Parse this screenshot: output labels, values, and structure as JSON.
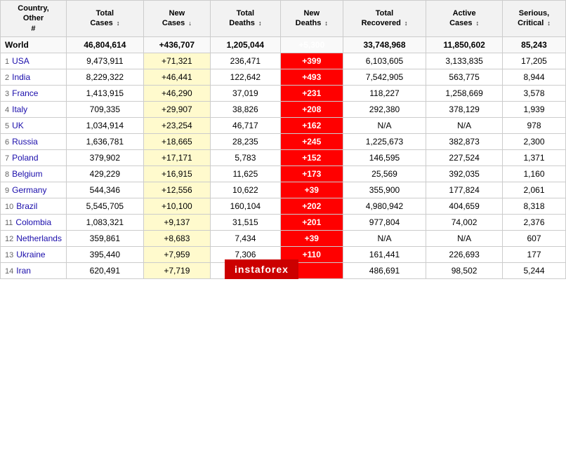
{
  "header": {
    "cols": [
      {
        "label": "Country,\nOther\n#",
        "class": "rank-col country-col-h"
      },
      {
        "label": "Total\nCases",
        "sort": true
      },
      {
        "label": "New\nCases",
        "sort": true,
        "active": true
      },
      {
        "label": "Total\nDeaths",
        "sort": true
      },
      {
        "label": "New\nDeaths",
        "sort": true
      },
      {
        "label": "Total\nRecovered",
        "sort": true
      },
      {
        "label": "Active\nCases",
        "sort": true
      },
      {
        "label": "Serious,\nCritical",
        "sort": true
      }
    ]
  },
  "world_row": {
    "name": "World",
    "total_cases": "46,804,614",
    "new_cases": "+436,707",
    "total_deaths": "1,205,044",
    "new_deaths": "+5,300",
    "total_recovered": "33,748,968",
    "active_cases": "11,850,602",
    "serious": "85,243"
  },
  "rows": [
    {
      "rank": "1",
      "country": "USA",
      "total_cases": "9,473,911",
      "new_cases": "+71,321",
      "total_deaths": "236,471",
      "new_deaths": "+399",
      "total_recovered": "6,103,605",
      "active_cases": "3,133,835",
      "serious": "17,205"
    },
    {
      "rank": "2",
      "country": "India",
      "total_cases": "8,229,322",
      "new_cases": "+46,441",
      "total_deaths": "122,642",
      "new_deaths": "+493",
      "total_recovered": "7,542,905",
      "active_cases": "563,775",
      "serious": "8,944"
    },
    {
      "rank": "3",
      "country": "France",
      "total_cases": "1,413,915",
      "new_cases": "+46,290",
      "total_deaths": "37,019",
      "new_deaths": "+231",
      "total_recovered": "118,227",
      "active_cases": "1,258,669",
      "serious": "3,578"
    },
    {
      "rank": "4",
      "country": "Italy",
      "total_cases": "709,335",
      "new_cases": "+29,907",
      "total_deaths": "38,826",
      "new_deaths": "+208",
      "total_recovered": "292,380",
      "active_cases": "378,129",
      "serious": "1,939"
    },
    {
      "rank": "5",
      "country": "UK",
      "total_cases": "1,034,914",
      "new_cases": "+23,254",
      "total_deaths": "46,717",
      "new_deaths": "+162",
      "total_recovered": "N/A",
      "active_cases": "N/A",
      "serious": "978"
    },
    {
      "rank": "6",
      "country": "Russia",
      "total_cases": "1,636,781",
      "new_cases": "+18,665",
      "total_deaths": "28,235",
      "new_deaths": "+245",
      "total_recovered": "1,225,673",
      "active_cases": "382,873",
      "serious": "2,300"
    },
    {
      "rank": "7",
      "country": "Poland",
      "total_cases": "379,902",
      "new_cases": "+17,171",
      "total_deaths": "5,783",
      "new_deaths": "+152",
      "total_recovered": "146,595",
      "active_cases": "227,524",
      "serious": "1,371"
    },
    {
      "rank": "8",
      "country": "Belgium",
      "total_cases": "429,229",
      "new_cases": "+16,915",
      "total_deaths": "11,625",
      "new_deaths": "+173",
      "total_recovered": "25,569",
      "active_cases": "392,035",
      "serious": "1,160"
    },
    {
      "rank": "9",
      "country": "Germany",
      "total_cases": "544,346",
      "new_cases": "+12,556",
      "total_deaths": "10,622",
      "new_deaths": "+39",
      "total_recovered": "355,900",
      "active_cases": "177,824",
      "serious": "2,061"
    },
    {
      "rank": "10",
      "country": "Brazil",
      "total_cases": "5,545,705",
      "new_cases": "+10,100",
      "total_deaths": "160,104",
      "new_deaths": "+202",
      "total_recovered": "4,980,942",
      "active_cases": "404,659",
      "serious": "8,318"
    },
    {
      "rank": "11",
      "country": "Colombia",
      "total_cases": "1,083,321",
      "new_cases": "+9,137",
      "total_deaths": "31,515",
      "new_deaths": "+201",
      "total_recovered": "977,804",
      "active_cases": "74,002",
      "serious": "2,376"
    },
    {
      "rank": "12",
      "country": "Netherlands",
      "total_cases": "359,861",
      "new_cases": "+8,683",
      "total_deaths": "7,434",
      "new_deaths": "+39",
      "total_recovered": "N/A",
      "active_cases": "N/A",
      "serious": "607"
    },
    {
      "rank": "13",
      "country": "Ukraine",
      "total_cases": "395,440",
      "new_cases": "+7,959",
      "total_deaths": "7,306",
      "new_deaths": "+110",
      "total_recovered": "161,441",
      "active_cases": "226,693",
      "serious": "177"
    },
    {
      "rank": "14",
      "country": "Iran",
      "total_cases": "620,491",
      "new_cases": "+7,719",
      "total_deaths": "",
      "new_deaths": "",
      "total_recovered": "486,691",
      "active_cases": "98,502",
      "serious": "5,244"
    }
  ],
  "instaforex": "instaforex"
}
